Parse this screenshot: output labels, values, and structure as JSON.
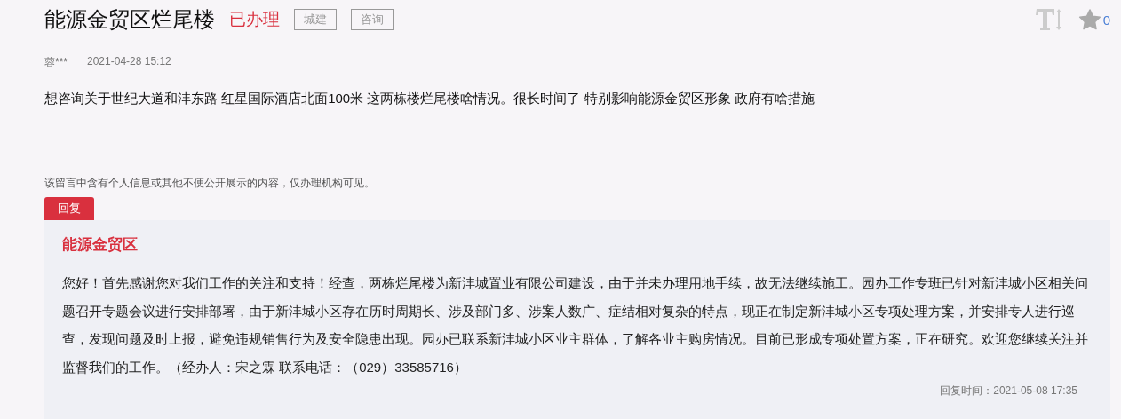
{
  "title": "能源金贸区烂尾楼",
  "status": "已办理",
  "tags": [
    "城建",
    "咨询"
  ],
  "star_count": "0",
  "author": "蓉***",
  "posted_time": "2021-04-28 15:12",
  "question": "想咨询关于世纪大道和沣东路 红星国际酒店北面100米 这两栋楼烂尾楼啥情况。很长时间了 特别影响能源金贸区形象 政府有啥措施",
  "privacy_note": "该留言中含有个人信息或其他不便公开展示的内容，仅办理机构可见。",
  "reply": {
    "tab": "回复",
    "org": "能源金贸区",
    "body": "您好！首先感谢您对我们工作的关注和支持！经查，两栋烂尾楼为新沣城置业有限公司建设，由于并未办理用地手续，故无法继续施工。园办工作专班已针对新沣城小区相关问题召开专题会议进行安排部署，由于新沣城小区存在历时周期长、涉及部门多、涉案人数广、症结相对复杂的特点，现正在制定新沣城小区专项处理方案，并安排专人进行巡查，发现问题及时上报，避免违规销售行为及安全隐患出现。园办已联系新沣城小区业主群体，了解各业主购房情况。目前已形成专项处置方案，正在研究。欢迎您继续关注并监督我们的工作。（经办人：宋之霖 联系电话：（029）33585716）",
    "time": "回复时间：2021-05-08 17:35"
  }
}
